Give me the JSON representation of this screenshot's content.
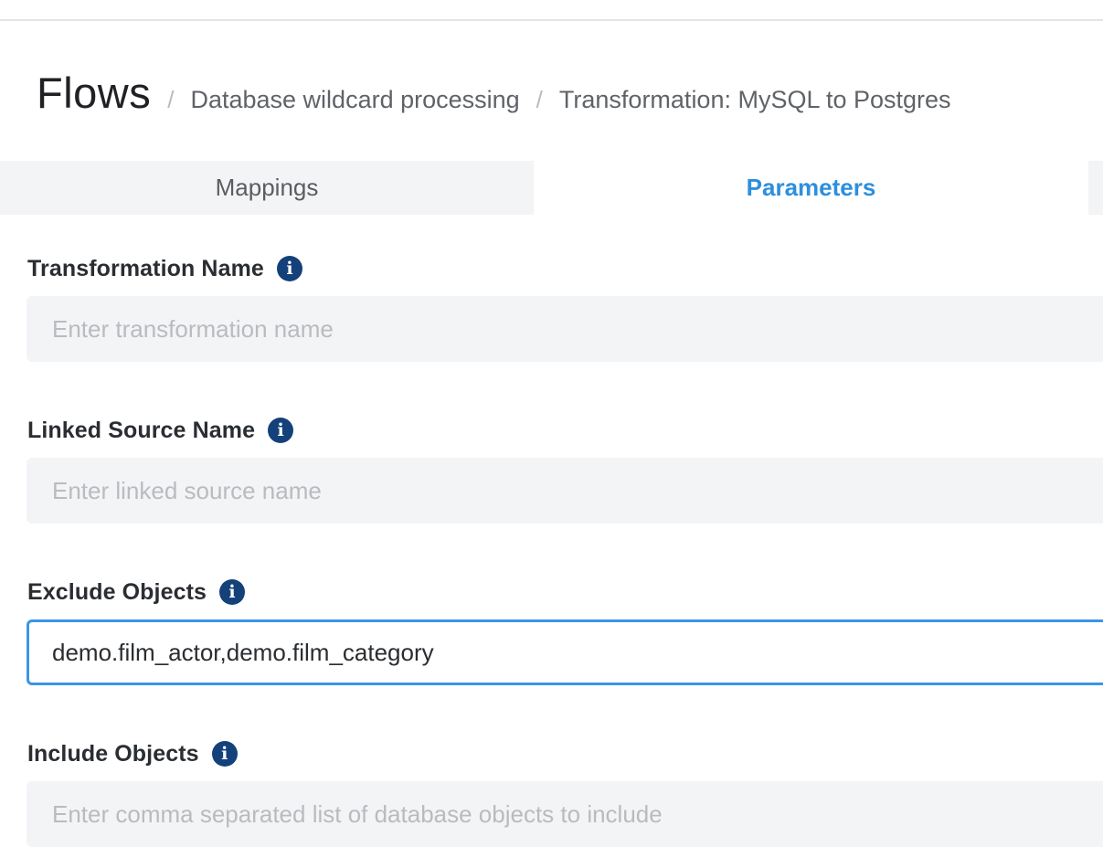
{
  "breadcrumb": {
    "root": "Flows",
    "separator": "/",
    "items": [
      "Database wildcard processing",
      "Transformation: MySQL to Postgres"
    ]
  },
  "tabs": [
    {
      "label": "Mappings",
      "active": false
    },
    {
      "label": "Parameters",
      "active": true
    }
  ],
  "fields": {
    "transformation_name": {
      "label": "Transformation Name",
      "value": "",
      "placeholder": "Enter transformation name"
    },
    "linked_source_name": {
      "label": "Linked Source Name",
      "value": "",
      "placeholder": "Enter linked source name"
    },
    "exclude_objects": {
      "label": "Exclude Objects",
      "value": "demo.film_actor,demo.film_category",
      "placeholder": ""
    },
    "include_objects": {
      "label": "Include Objects",
      "value": "",
      "placeholder": "Enter comma separated list of database objects to include"
    }
  },
  "icons": {
    "info": "info-icon"
  },
  "colors": {
    "accent": "#2d8fdd",
    "focus_border": "#3b95e3",
    "info_icon": "#14417a",
    "input_bg": "#f3f4f6",
    "placeholder": "#b9bbbf"
  }
}
